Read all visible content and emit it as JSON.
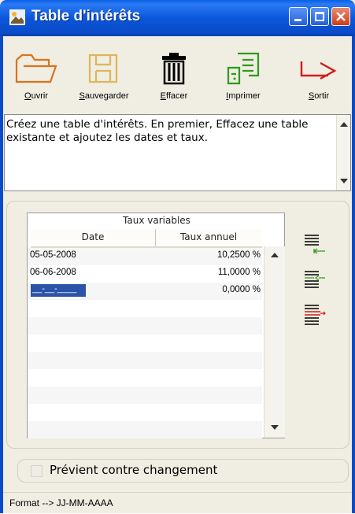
{
  "window": {
    "title": "Table d'intérêts"
  },
  "toolbar": [
    {
      "label": "Ouvrir",
      "icon": "folder-open-icon",
      "color": "#d9731d"
    },
    {
      "label": "Sauvegarder",
      "icon": "save-disk-icon",
      "color": "#dcb65a"
    },
    {
      "label": "Effacer",
      "icon": "trash-icon",
      "color": "#000000"
    },
    {
      "label": "Imprimer",
      "icon": "print-doc-icon",
      "color": "#2e9a1e"
    },
    {
      "label": "Sortir",
      "icon": "exit-arrow-icon",
      "color": "#d21a1a"
    }
  ],
  "message": {
    "text": "Créez une table d'intérêts. En premier, Effacez une table existante et ajoutez les dates et taux."
  },
  "table": {
    "caption": "Taux variables",
    "headers": {
      "date": "Date",
      "rate": "Taux annuel"
    },
    "rows": [
      {
        "date": "05-05-2008",
        "rate": "10,2500 %"
      },
      {
        "date": "06-06-2008",
        "rate": "11,0000 %"
      },
      {
        "date": "__-__-____",
        "rate": "0,0000 %"
      }
    ]
  },
  "side_buttons": [
    "insert-row-icon",
    "add-row-icon",
    "delete-row-icon"
  ],
  "options": {
    "prevent_change_label": "Prévient contre changement",
    "prevent_change_checked": false
  },
  "status": {
    "text": "Format --> JJ-MM-AAAA"
  }
}
